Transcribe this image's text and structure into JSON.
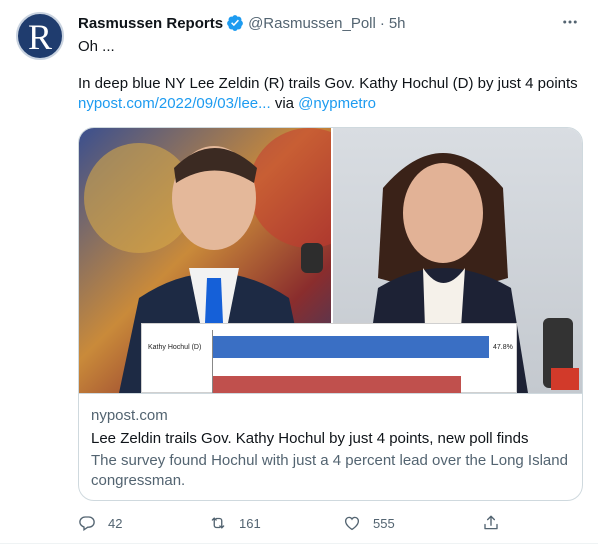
{
  "tweet": {
    "author_name": "Rasmussen Reports",
    "handle": "@Rasmussen_Poll",
    "separator": "·",
    "time": "5h",
    "avatar_letter": "R",
    "text_line1": "Oh ...",
    "text_line2": "In deep blue NY Lee Zeldin (R) trails Gov. Kathy Hochul (D) by just 4 points",
    "link_url": "nypost.com/2022/09/03/lee...",
    "via_text": "via",
    "via_mention": "@nypmetro"
  },
  "card": {
    "poll_label": "Kathy Hochul (D)",
    "poll_value": "47.8%",
    "domain": "nypost.com",
    "title": "Lee Zeldin trails Gov. Kathy Hochul by just 4 points, new poll finds",
    "description": "The survey found Hochul with just a 4 percent lead over the Long Island congressman."
  },
  "actions": {
    "reply_count": "42",
    "retweet_count": "161",
    "like_count": "555"
  },
  "colors": {
    "link": "#1d9bf0",
    "secondary_text": "#536471",
    "verified_badge": "#1d9bf0"
  },
  "icons": [
    "verified-badge-icon",
    "more-options-icon",
    "reply-icon",
    "retweet-icon",
    "like-icon",
    "share-icon"
  ]
}
